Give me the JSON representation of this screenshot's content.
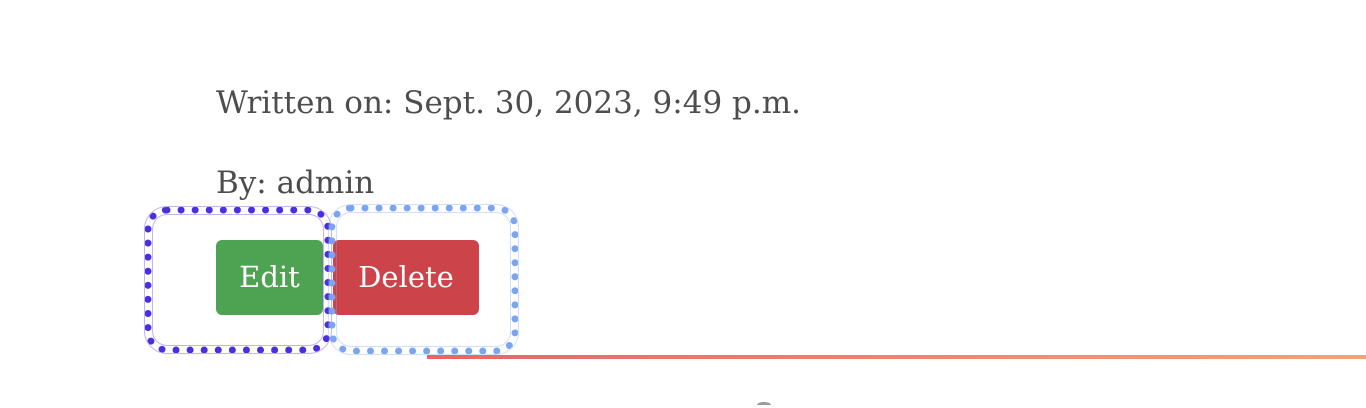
{
  "post_meta": {
    "written_on": "Written on: Sept. 30, 2023, 9:49 p.m.",
    "author": "By: admin"
  },
  "actions": {
    "edit_label": "Edit",
    "delete_label": "Delete"
  },
  "colors": {
    "edit_button": "#4ea352",
    "delete_button": "#cc434a",
    "highlight_edit": "#4a2fe0",
    "highlight_delete": "#7da4ee",
    "divider_start": "#e8646a",
    "divider_end": "#f0a37b",
    "text": "#4d4d4d"
  }
}
